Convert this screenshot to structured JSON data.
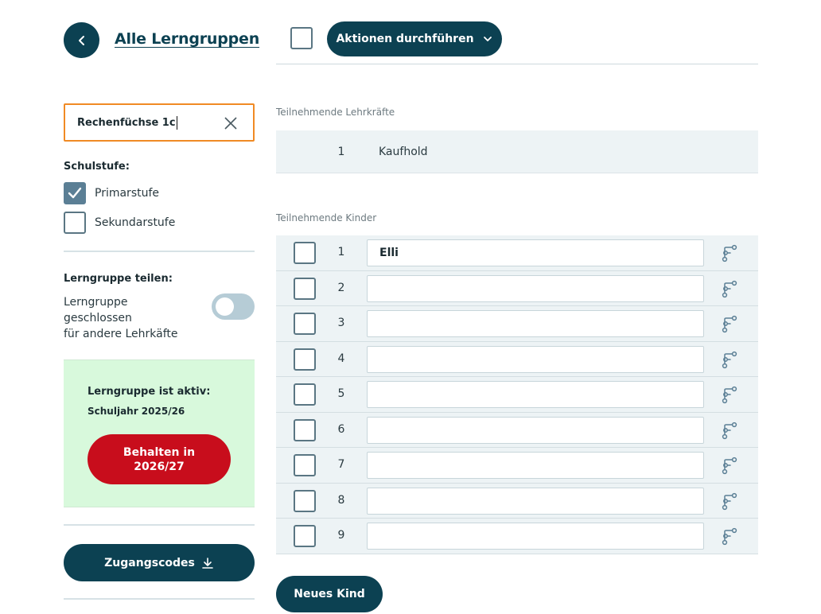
{
  "header": {
    "back_icon": "chevron-left-icon",
    "title": "Alle Lerngruppen",
    "actions_label": "Aktionen durchführen",
    "actions_icon": "chevron-down-icon"
  },
  "search": {
    "value": "Rechenfüchse 1c",
    "clear_icon": "close-icon"
  },
  "schulstufe": {
    "heading": "Schulstufe:",
    "options": [
      {
        "label": "Primarstufe",
        "checked": true
      },
      {
        "label": "Sekundarstufe",
        "checked": false
      }
    ]
  },
  "share": {
    "heading": "Lerngruppe teilen:",
    "line1": "Lerngruppe",
    "line2": "geschlossen",
    "line3": "für andere Lehrkäfte",
    "toggle_on": false
  },
  "status": {
    "heading": "Lerngruppe ist aktiv:",
    "year": "Schuljahr 2025/26",
    "keep_line1": "Behalten in",
    "keep_line2": "2026/27"
  },
  "codes": {
    "label": "Zugangscodes",
    "icon": "download-icon"
  },
  "teachers": {
    "heading": "Teilnehmende Lehrkräfte",
    "rows": [
      {
        "num": "1",
        "name": "Kaufhold"
      }
    ]
  },
  "kids": {
    "heading": "Teilnehmende Kinder",
    "rows": [
      {
        "num": "1",
        "name": "Elli"
      },
      {
        "num": "2",
        "name": ""
      },
      {
        "num": "3",
        "name": ""
      },
      {
        "num": "4",
        "name": ""
      },
      {
        "num": "5",
        "name": ""
      },
      {
        "num": "6",
        "name": ""
      },
      {
        "num": "7",
        "name": ""
      },
      {
        "num": "8",
        "name": ""
      },
      {
        "num": "9",
        "name": ""
      }
    ],
    "row_icon": "learning-path-icon",
    "add_label": "Neues Kind"
  },
  "colors": {
    "primary": "#0c4152",
    "danger": "#c80d1c",
    "focus": "#f08a24",
    "success_bg": "#d8f9dc"
  }
}
